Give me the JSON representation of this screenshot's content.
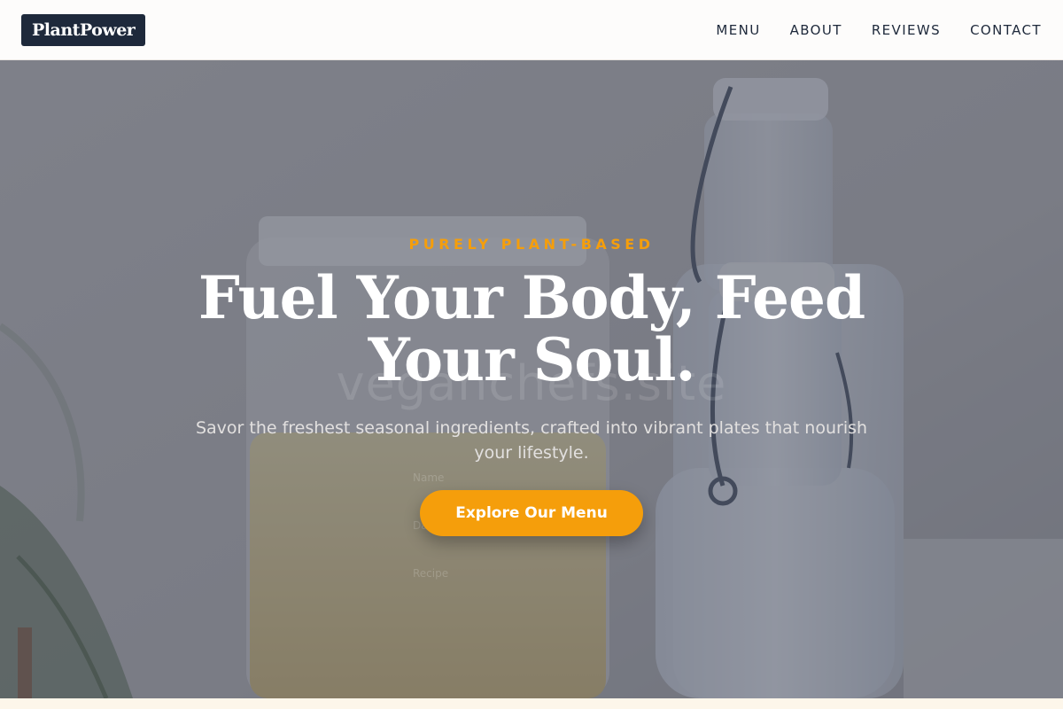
{
  "nav": {
    "logo": "PlantPower",
    "links": [
      "MENU",
      "ABOUT",
      "REVIEWS",
      "CONTACT"
    ]
  },
  "hero": {
    "eyebrow": "PURELY PLANT-BASED",
    "headline": "Fuel Your Body, Feed Your Soul.",
    "subtitle": "Savor the freshest seasonal ingredients, crafted into vibrant plates that nourish your lifestyle.",
    "cta_label": "Explore Our Menu",
    "watermark": "veganchefs.site",
    "jar_labels": [
      "Name",
      "Date",
      "Recipe"
    ]
  },
  "colors": {
    "accent": "#f59e0b",
    "logo_bg": "#1e293b",
    "nav_text": "#1e293b",
    "overlay": "#3c4254"
  }
}
